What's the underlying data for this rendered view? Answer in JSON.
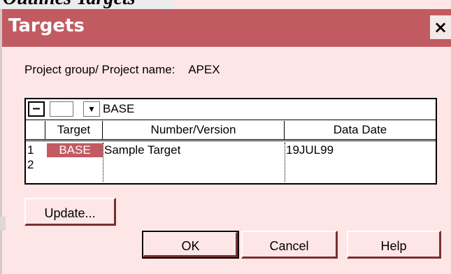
{
  "top_caption": "Outlines Targets",
  "dialog": {
    "title": "Targets",
    "close_glyph": "×",
    "project_label": "Project group/ Project name:",
    "project_value": "APEX"
  },
  "grid": {
    "minus_glyph": "–",
    "dropdown_glyph": "▼",
    "selected_value": "BASE",
    "columns": [
      "Target",
      "Number/Version",
      "Data Date"
    ],
    "rows": [
      {
        "num": "1",
        "target": "BASE",
        "number_version": "Sample Target",
        "data_date": "19JUL99"
      },
      {
        "num": "2",
        "target": "",
        "number_version": "",
        "data_date": ""
      }
    ]
  },
  "buttons": {
    "update": "Update...",
    "ok": "OK",
    "cancel": "Cancel",
    "help": "Help"
  },
  "colors": {
    "titlebar": "#c25a62",
    "background": "#ffe6e6"
  }
}
